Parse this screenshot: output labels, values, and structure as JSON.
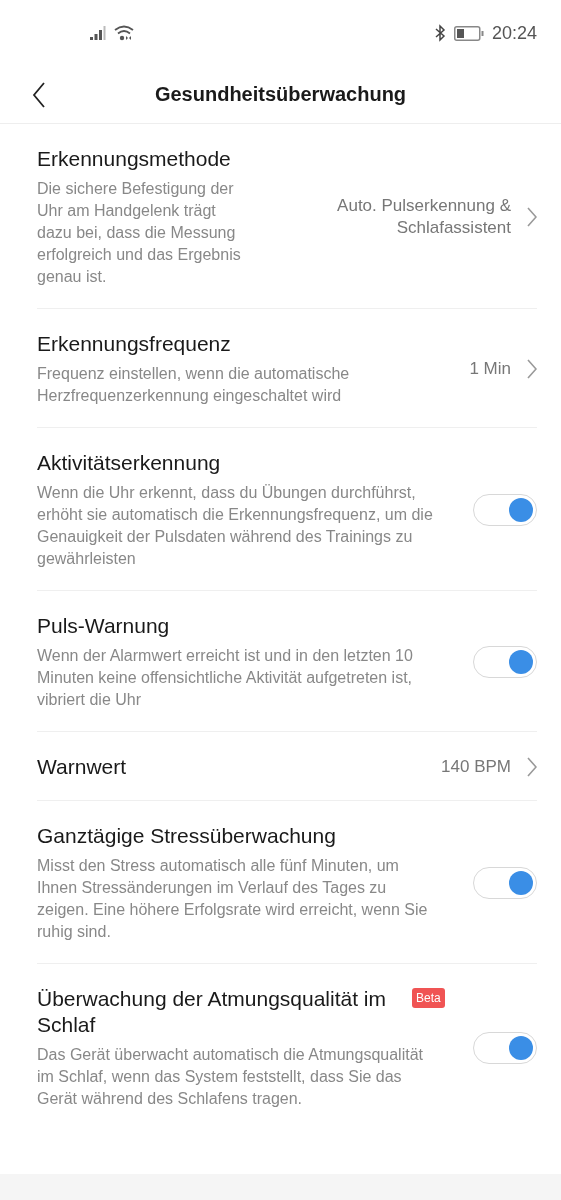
{
  "status_bar": {
    "time": "20:24"
  },
  "header": {
    "title": "Gesundheitsüberwachung"
  },
  "rows": [
    {
      "kind": "value",
      "title": "Erkennungsmethode",
      "description": "Die sichere Befestigung der Uhr am Handgelenk trägt dazu bei, dass die Messung erfolgreich und das Ergebnis genau ist.",
      "value": "Auto. Pulserkennung & Schlafassistent"
    },
    {
      "kind": "value",
      "title": "Erkennungsfrequenz",
      "description": "Frequenz einstellen, wenn die automatische Herzfrequenzerkennung eingeschaltet wird",
      "value": "1 Min"
    },
    {
      "kind": "toggle",
      "title": "Aktivitätserkennung",
      "description": "Wenn die Uhr erkennt, dass du Übungen durchführst, erhöht sie automatisch die Erkennungsfrequenz, um die Genauigkeit der Pulsdaten während des Trainings zu gewährleisten",
      "on": true
    },
    {
      "kind": "toggle",
      "title": "Puls-Warnung",
      "description": "Wenn der Alarmwert erreicht ist und in den letzten 10 Minuten keine offensichtliche Aktivität aufgetreten ist, vibriert die Uhr",
      "on": true
    },
    {
      "kind": "value",
      "title": "Warnwert",
      "value": "140 BPM"
    },
    {
      "kind": "toggle",
      "title": "Ganztägige Stressüberwachung",
      "description": "Misst den Stress automatisch alle fünf Minuten, um Ihnen Stressänderungen im Verlauf des Tages zu zeigen. Eine höhere Erfolgsrate wird erreicht, wenn Sie ruhig sind.",
      "on": true
    },
    {
      "kind": "toggle",
      "title": "Überwachung der Atmungsqualität im Schlaf",
      "badge": "Beta",
      "description": "Das Gerät überwacht automatisch die Atmungsqualität im Schlaf, wenn das System feststellt, dass Sie das Gerät während des Schlafens tragen.",
      "on": true
    }
  ]
}
